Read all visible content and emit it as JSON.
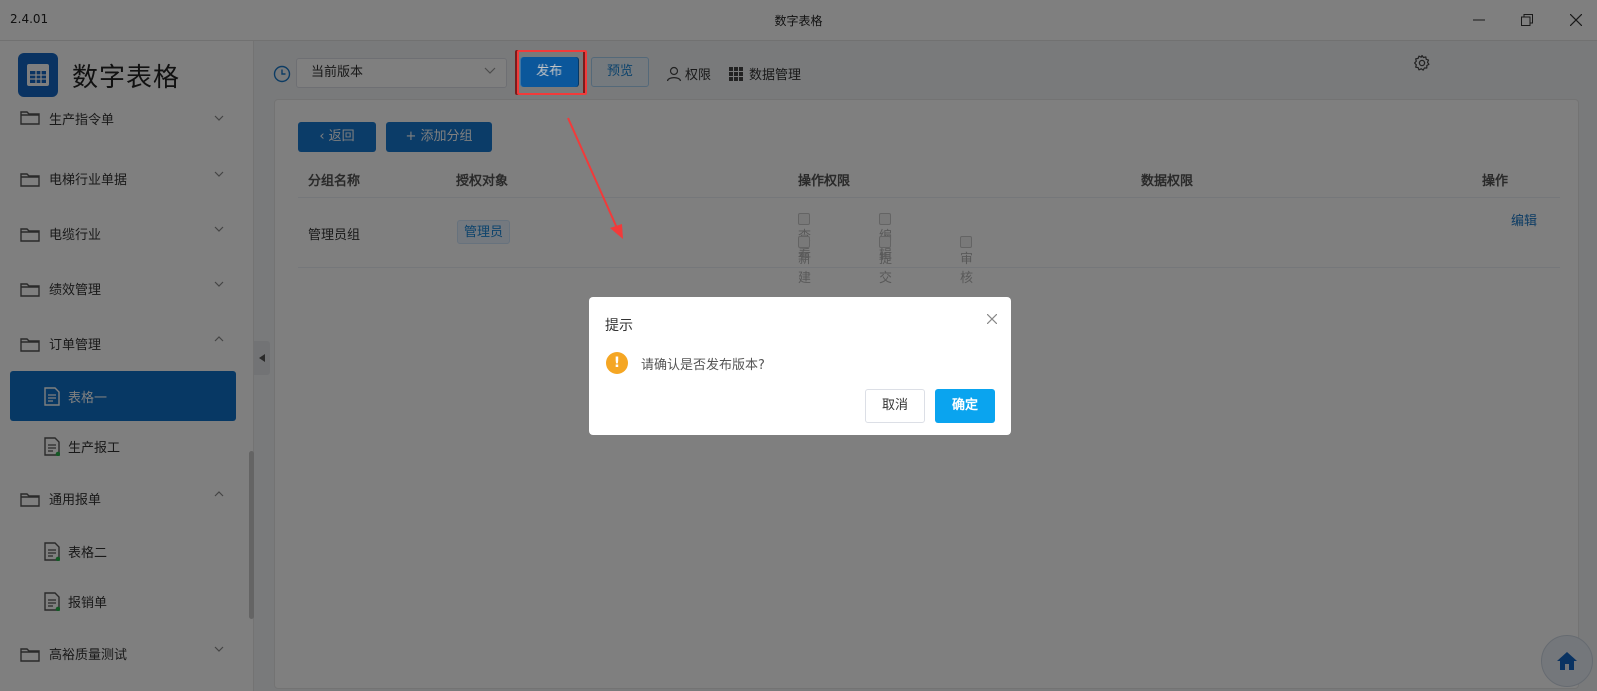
{
  "window": {
    "version": "2.4.01",
    "title": "数字表格"
  },
  "sidebar": {
    "logo_text": "数字表格",
    "menu": [
      {
        "label": "生产指令单",
        "expanded": false,
        "children": []
      },
      {
        "label": "电梯行业单据",
        "expanded": false,
        "children": []
      },
      {
        "label": "电缆行业",
        "expanded": false,
        "children": []
      },
      {
        "label": "绩效管理",
        "expanded": false,
        "children": []
      },
      {
        "label": "订单管理",
        "expanded": true,
        "children": [
          {
            "label": "表格一",
            "active": true
          },
          {
            "label": "生产报工",
            "active": false
          }
        ]
      },
      {
        "label": "通用报单",
        "expanded": true,
        "children": [
          {
            "label": "表格二",
            "active": false
          },
          {
            "label": "报销单",
            "active": false
          }
        ]
      },
      {
        "label": "高裕质量测试",
        "expanded": false,
        "children": []
      }
    ]
  },
  "toolbar": {
    "version_select": "当前版本",
    "publish_label": "发布",
    "preview_label": "预览",
    "permission_label": "权限",
    "data_manage_label": "数据管理"
  },
  "panel": {
    "back_label": "返回",
    "add_group_label": "添加分组",
    "columns": [
      "分组名称",
      "授权对象",
      "操作权限",
      "数据权限",
      "操作"
    ],
    "rows": [
      {
        "group": "管理员组",
        "target": "管理员",
        "ops": [
          "查看",
          "编辑",
          "新建",
          "提交",
          "审核"
        ],
        "action": "编辑"
      }
    ]
  },
  "dialog": {
    "title": "提示",
    "message": "请确认是否发布版本?",
    "cancel_label": "取消",
    "ok_label": "确定"
  },
  "colors": {
    "primary": "#0f71c9",
    "confirm": "#0aa4ef",
    "warning": "#f5a623",
    "highlight": "#f23a3a"
  }
}
